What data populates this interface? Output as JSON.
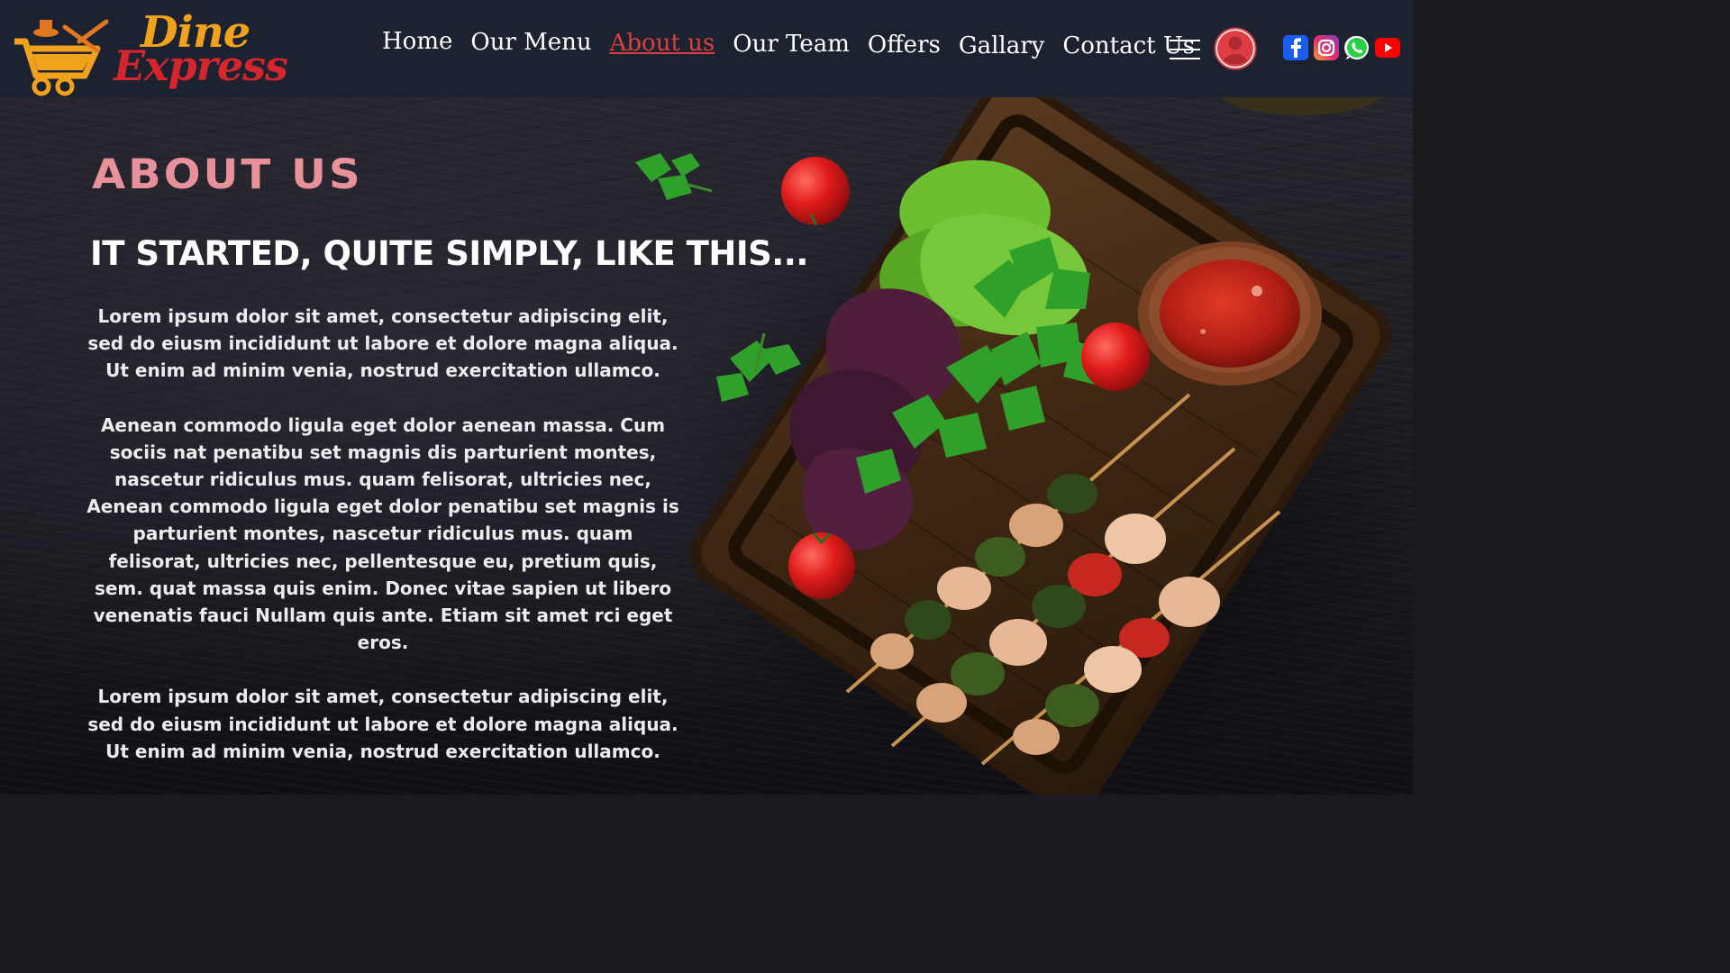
{
  "brand": {
    "name_line1": "Dine",
    "name_line2": "Express"
  },
  "nav": {
    "links": [
      "Home",
      "Our Menu",
      "About us",
      "Our Team",
      "Offers",
      "Gallary",
      "Contact Us"
    ],
    "active": "About us"
  },
  "icons": {
    "menu": "hamburger-icon",
    "account": "user-icon",
    "socials": [
      "facebook-icon",
      "instagram-icon",
      "whatsapp-icon",
      "youtube-icon"
    ]
  },
  "colors": {
    "nav_bg": "#1d2230",
    "accent_red": "#d94040",
    "title_pink": "#e8919a",
    "logo_orange": "#f0a21d",
    "logo_red": "#d5262e"
  },
  "about": {
    "title": "About Us",
    "subtitle": "IT STARTED, QUITE SIMPLY, LIKE THIS...",
    "paragraphs": [
      "Lorem ipsum dolor sit amet, consectetur adipiscing elit, sed do eiusm incididunt ut labore et dolore magna aliqua. Ut enim ad minim venia, nostrud exercitation ullamco.",
      "Aenean commodo ligula eget dolor aenean massa. Cum sociis nat penatibu set magnis dis parturient montes, nascetur ridiculus mus. quam felisorat, ultricies nec, Aenean commodo ligula eget dolor penatibu set magnis is parturient montes, nascetur ridiculus mus. quam felisorat, ultricies nec, pellentesque eu, pretium quis, sem. quat massa quis enim. Donec vitae sapien ut libero venenatis fauci Nullam quis ante. Etiam sit amet rci eget eros.",
      "Lorem ipsum dolor sit amet, consectetur adipiscing elit, sed do eiusm incididunt ut labore et dolore magna aliqua. Ut enim ad minim venia, nostrud exercitation ullamco."
    ]
  }
}
